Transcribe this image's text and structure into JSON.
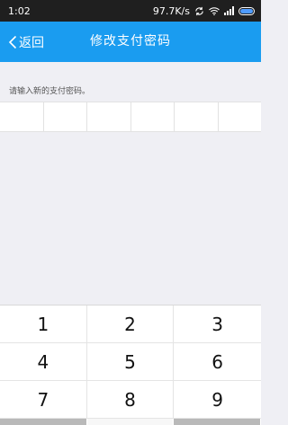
{
  "status_bar": {
    "time": "1:02",
    "network_speed": "97.7K/s",
    "icons": [
      "sync-icon",
      "wifi-icon",
      "signal-icon",
      "battery-icon"
    ]
  },
  "nav": {
    "back_label": "返回",
    "title": "修改支付密码"
  },
  "instruction": "请输入新的支付密码。",
  "pin_fields": 6,
  "keypad": {
    "keys": [
      "1",
      "2",
      "3",
      "4",
      "5",
      "6",
      "7",
      "8",
      "9"
    ]
  },
  "colors": {
    "nav_background": "#1a9cf0",
    "status_background": "#1f1f1f",
    "page_background": "#efeff4"
  }
}
